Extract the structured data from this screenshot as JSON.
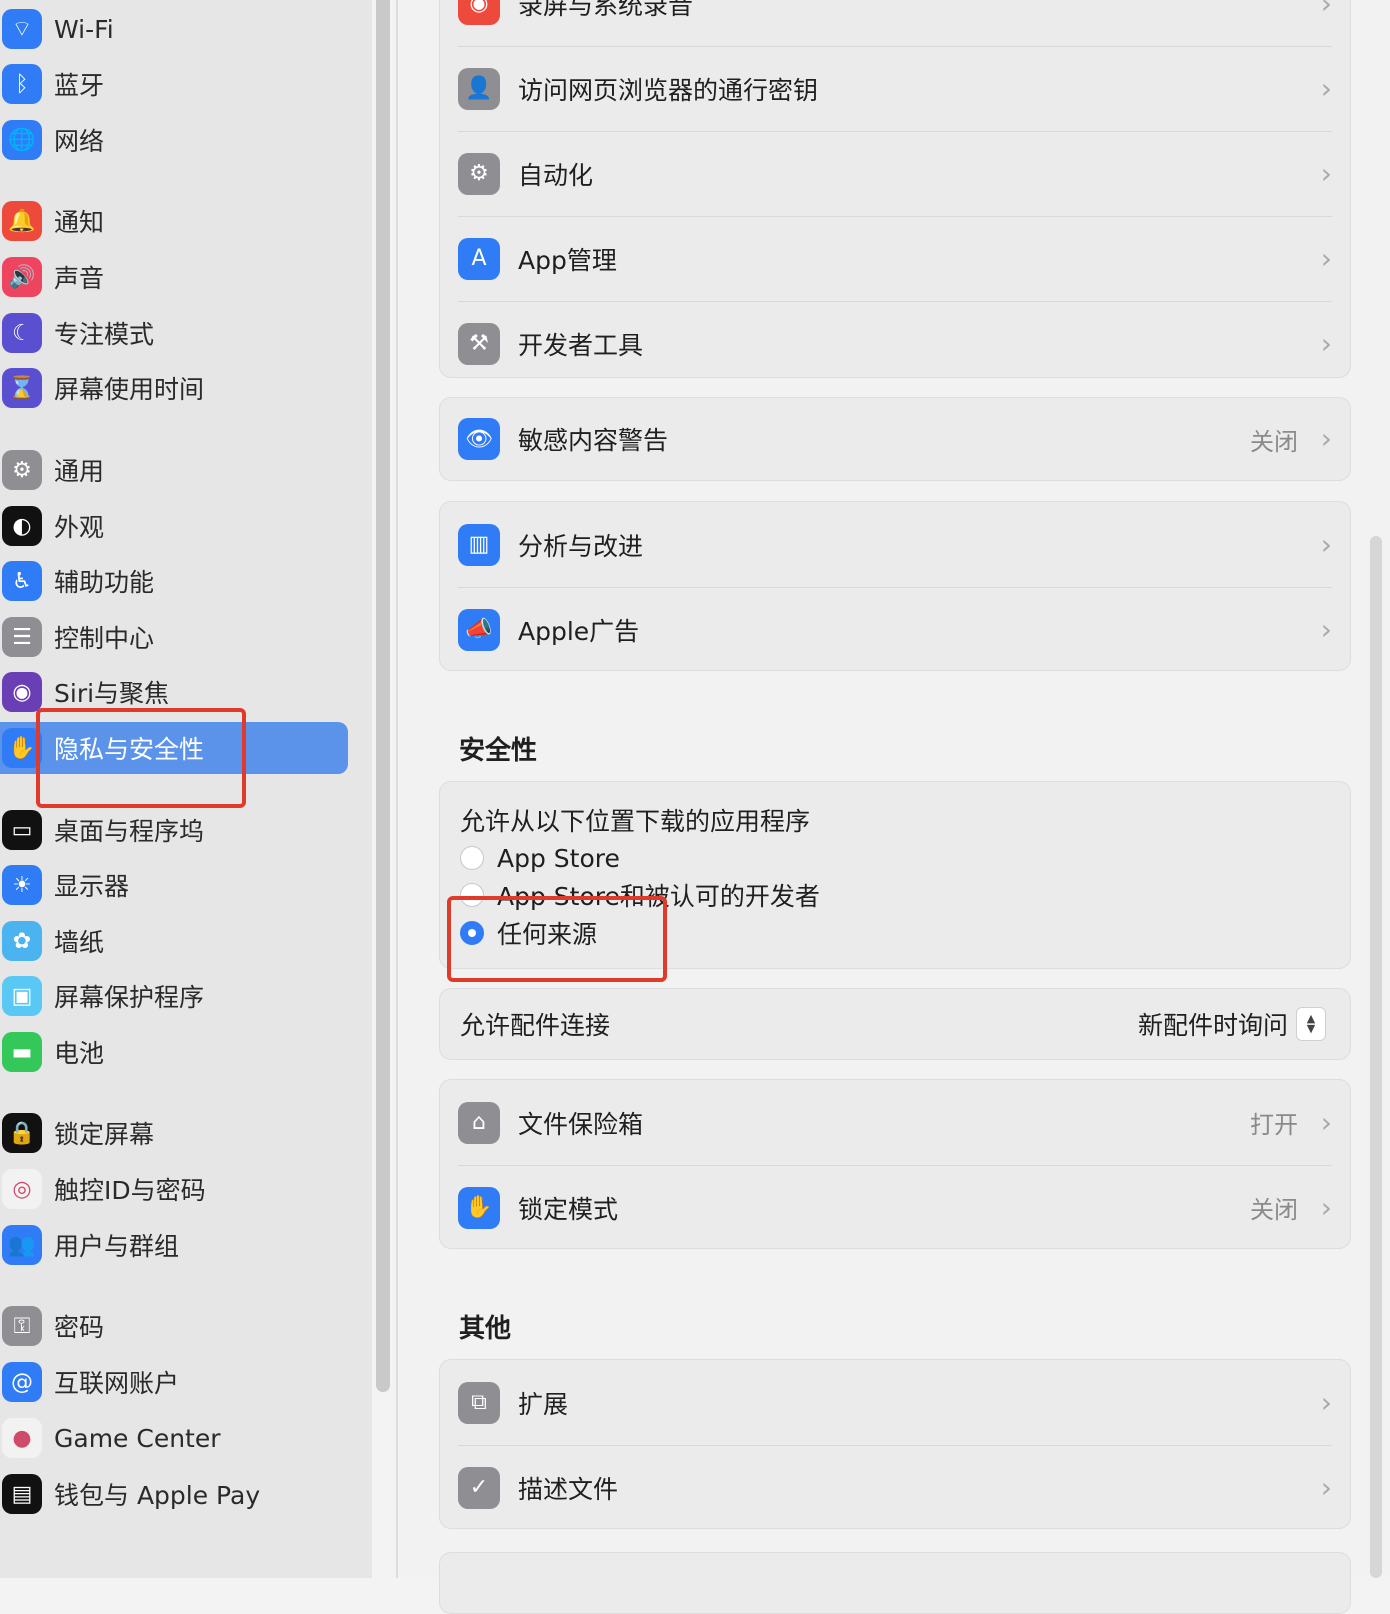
{
  "sidebar": {
    "items": [
      {
        "label": "Wi-Fi",
        "icon": "wifi-icon",
        "color": "#2f7cf6",
        "glyph": "⌔"
      },
      {
        "label": "蓝牙",
        "icon": "bluetooth-icon",
        "color": "#2f7cf6",
        "glyph": "ᛒ"
      },
      {
        "label": "网络",
        "icon": "globe-icon",
        "color": "#2f7cf6",
        "glyph": "🌐"
      },
      {
        "label": "通知",
        "icon": "bell-icon",
        "color": "#ee4a3c",
        "glyph": "🔔"
      },
      {
        "label": "声音",
        "icon": "speaker-icon",
        "color": "#ee4460",
        "glyph": "🔊"
      },
      {
        "label": "专注模式",
        "icon": "moon-icon",
        "color": "#5a4fd0",
        "glyph": "☾"
      },
      {
        "label": "屏幕使用时间",
        "icon": "hourglass-icon",
        "color": "#5a4fd0",
        "glyph": "⌛"
      },
      {
        "label": "通用",
        "icon": "gear-icon",
        "color": "#8e8e93",
        "glyph": "⚙"
      },
      {
        "label": "外观",
        "icon": "appearance-icon",
        "color": "#111111",
        "glyph": "◐"
      },
      {
        "label": "辅助功能",
        "icon": "accessibility-icon",
        "color": "#2f7cf6",
        "glyph": "♿"
      },
      {
        "label": "控制中心",
        "icon": "toggles-icon",
        "color": "#8e8e93",
        "glyph": "☰"
      },
      {
        "label": "Siri与聚焦",
        "icon": "siri-icon",
        "color": "#6a3fb5",
        "glyph": "◉"
      },
      {
        "label": "隐私与安全性",
        "icon": "hand-icon",
        "color": "#2f7cf6",
        "glyph": "✋"
      },
      {
        "label": "桌面与程序坞",
        "icon": "dock-icon",
        "color": "#111111",
        "glyph": "▭"
      },
      {
        "label": "显示器",
        "icon": "sun-icon",
        "color": "#2f7cf6",
        "glyph": "☀"
      },
      {
        "label": "墙纸",
        "icon": "flower-icon",
        "color": "#4bb3f0",
        "glyph": "✿"
      },
      {
        "label": "屏幕保护程序",
        "icon": "screensaver-icon",
        "color": "#5ac8f5",
        "glyph": "▣"
      },
      {
        "label": "电池",
        "icon": "battery-icon",
        "color": "#34c759",
        "glyph": "▬"
      },
      {
        "label": "锁定屏幕",
        "icon": "lock-icon",
        "color": "#111111",
        "glyph": "🔒"
      },
      {
        "label": "触控ID与密码",
        "icon": "fingerprint-icon",
        "color": "#f2f2f2",
        "glyph": "◎"
      },
      {
        "label": "用户与群组",
        "icon": "users-icon",
        "color": "#2f7cf6",
        "glyph": "👥"
      },
      {
        "label": "密码",
        "icon": "key-icon",
        "color": "#8e8e93",
        "glyph": "⚿"
      },
      {
        "label": "互联网账户",
        "icon": "at-icon",
        "color": "#2f7cf6",
        "glyph": "@"
      },
      {
        "label": "Game Center",
        "icon": "game-center-icon",
        "color": "#f2f2f2",
        "glyph": "●"
      },
      {
        "label": "钱包与 Apple Pay",
        "icon": "wallet-icon",
        "color": "#111111",
        "glyph": "▤"
      }
    ],
    "selected_label": "隐私与安全性"
  },
  "main": {
    "card1": {
      "rows": [
        {
          "label": "录屏与系统录音",
          "icon": "record-icon",
          "color": "#ee4a3c",
          "glyph": "◉"
        },
        {
          "label": "访问网页浏览器的通行密钥",
          "icon": "person-key-icon",
          "color": "#8e8e93",
          "glyph": "👤"
        },
        {
          "label": "自动化",
          "icon": "gears-icon",
          "color": "#8e8e93",
          "glyph": "⚙"
        },
        {
          "label": "App管理",
          "icon": "app-store-icon",
          "color": "#2f7cf6",
          "glyph": "A"
        },
        {
          "label": "开发者工具",
          "icon": "hammer-icon",
          "color": "#8e8e93",
          "glyph": "⚒"
        }
      ]
    },
    "card2": {
      "label": "敏感内容警告",
      "value": "关闭",
      "icon": "eye-icon",
      "color": "#2f7cf6",
      "glyph": "👁"
    },
    "card3": {
      "rows": [
        {
          "label": "分析与改进",
          "icon": "chart-icon",
          "color": "#2f7cf6",
          "glyph": "▥"
        },
        {
          "label": "Apple广告",
          "icon": "megaphone-icon",
          "color": "#2f7cf6",
          "glyph": "📣"
        }
      ]
    },
    "security": {
      "title": "安全性",
      "download_label": "允许从以下位置下载的应用程序",
      "options": [
        "App Store",
        "App Store和被认可的开发者",
        "任何来源"
      ],
      "selected_option": "任何来源",
      "accessory_label": "允许配件连接",
      "accessory_value": "新配件时询问"
    },
    "card4": {
      "rows": [
        {
          "label": "文件保险箱",
          "value": "打开",
          "icon": "vault-icon",
          "color": "#8e8e93",
          "glyph": "⌂"
        },
        {
          "label": "锁定模式",
          "value": "关闭",
          "icon": "hand-icon",
          "color": "#2f7cf6",
          "glyph": "✋"
        }
      ]
    },
    "other": {
      "title": "其他",
      "rows": [
        {
          "label": "扩展",
          "icon": "puzzle-icon",
          "color": "#8e8e93",
          "glyph": "⧉"
        },
        {
          "label": "描述文件",
          "icon": "check-badge-icon",
          "color": "#8e8e93",
          "glyph": "✓"
        }
      ]
    }
  }
}
